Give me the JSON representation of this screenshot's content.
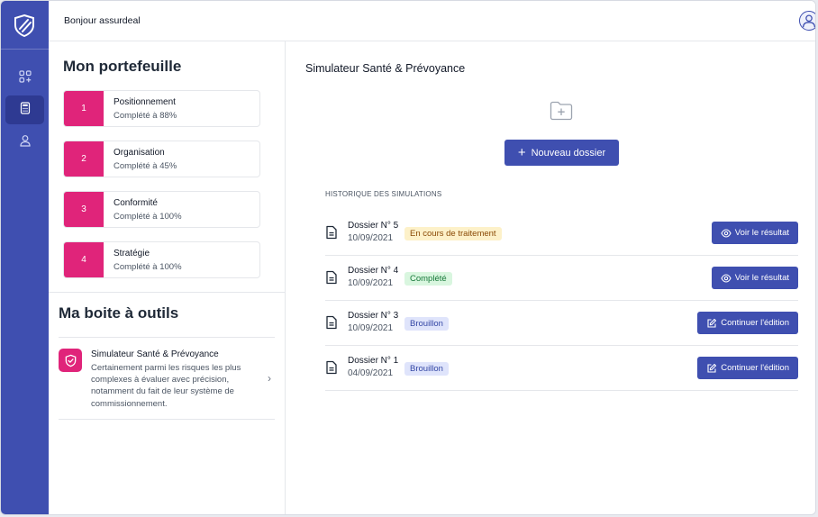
{
  "topbar": {
    "greeting": "Bonjour assurdeal"
  },
  "sidebar": {
    "items": [
      {
        "icon": "apps-add-icon",
        "active": false
      },
      {
        "icon": "calculator-icon",
        "active": true
      },
      {
        "icon": "user-icon",
        "active": false
      }
    ]
  },
  "portfolio": {
    "title": "Mon portefeuille",
    "items": [
      {
        "number": "1",
        "title": "Positionnement",
        "status": "Complété à 88%"
      },
      {
        "number": "2",
        "title": "Organisation",
        "status": "Complété à 45%"
      },
      {
        "number": "3",
        "title": "Conformité",
        "status": "Complété à 100%"
      },
      {
        "number": "4",
        "title": "Stratégie",
        "status": "Complété à 100%"
      }
    ]
  },
  "toolbox": {
    "title": "Ma boite à outils",
    "tool": {
      "title": "Simulateur Santé & Prévoyance",
      "description": "Certainement parmi les risques les plus complexes à évaluer avec précision, notamment du fait de leur système de commissionnement."
    }
  },
  "main": {
    "title": "Simulateur Santé & Prévoyance",
    "new_button": "Nouveau dossier",
    "history_label": "HISTORIQUE DES SIMULATIONS",
    "rows": [
      {
        "title": "Dossier N° 5",
        "date": "10/09/2021",
        "status": "En cours de traitement",
        "action": "Voir le résultat"
      },
      {
        "title": "Dossier N° 4",
        "date": "10/09/2021",
        "status": "Complété",
        "action": "Voir le résultat"
      },
      {
        "title": "Dossier N° 3",
        "date": "10/09/2021",
        "status": "Brouillon",
        "action": "Continuer l'édition"
      },
      {
        "title": "Dossier N° 1",
        "date": "04/09/2021",
        "status": "Brouillon",
        "action": "Continuer l'édition"
      }
    ]
  },
  "colors": {
    "primary": "#3f4fb0",
    "accent": "#e0247a"
  }
}
